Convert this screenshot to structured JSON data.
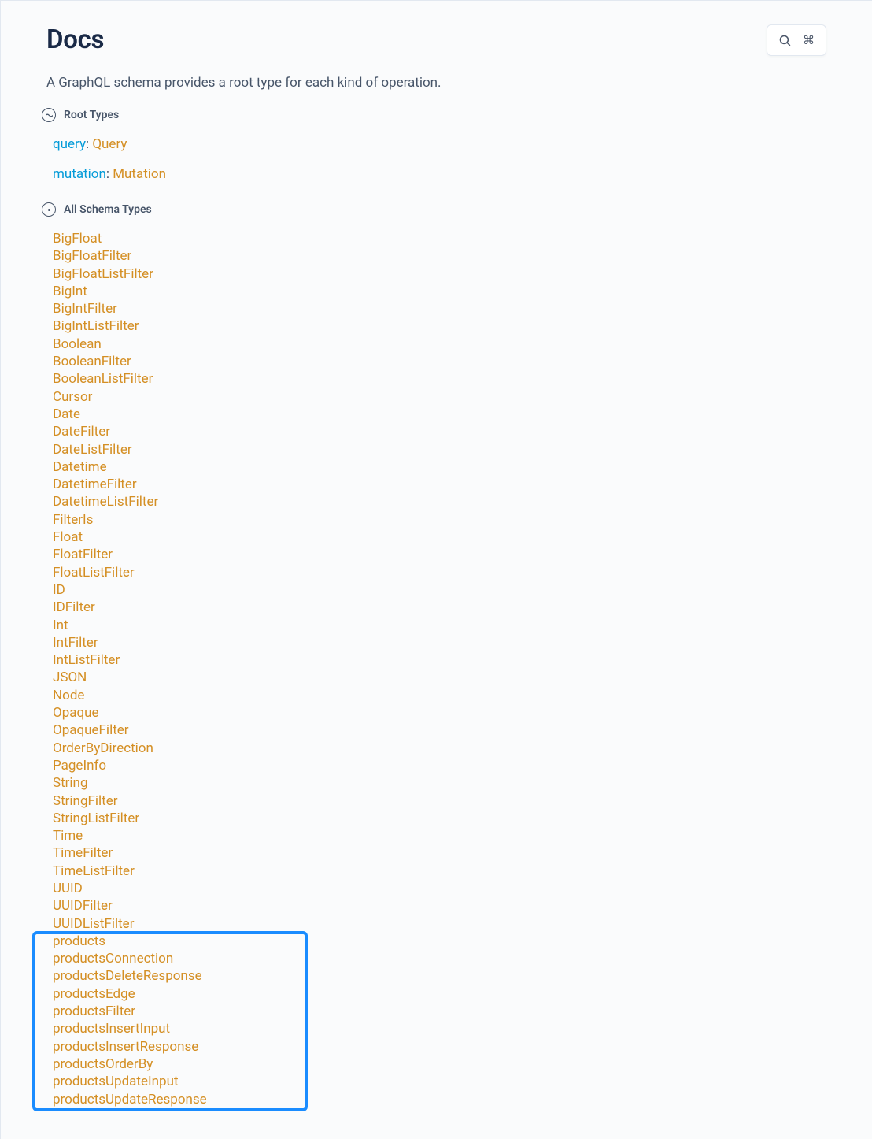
{
  "header": {
    "title": "Docs"
  },
  "description": "A GraphQL schema provides a root type for each kind of operation.",
  "sections": {
    "root_types_label": "Root Types",
    "all_schema_types_label": "All Schema Types"
  },
  "root_types": [
    {
      "key": "query",
      "value": "Query"
    },
    {
      "key": "mutation",
      "value": "Mutation"
    }
  ],
  "schema_types": [
    "BigFloat",
    "BigFloatFilter",
    "BigFloatListFilter",
    "BigInt",
    "BigIntFilter",
    "BigIntListFilter",
    "Boolean",
    "BooleanFilter",
    "BooleanListFilter",
    "Cursor",
    "Date",
    "DateFilter",
    "DateListFilter",
    "Datetime",
    "DatetimeFilter",
    "DatetimeListFilter",
    "FilterIs",
    "Float",
    "FloatFilter",
    "FloatListFilter",
    "ID",
    "IDFilter",
    "Int",
    "IntFilter",
    "IntListFilter",
    "JSON",
    "Node",
    "Opaque",
    "OpaqueFilter",
    "OrderByDirection",
    "PageInfo",
    "String",
    "StringFilter",
    "StringListFilter",
    "Time",
    "TimeFilter",
    "TimeListFilter",
    "UUID",
    "UUIDFilter",
    "UUIDListFilter",
    "products",
    "productsConnection",
    "productsDeleteResponse",
    "productsEdge",
    "productsFilter",
    "productsInsertInput",
    "productsInsertResponse",
    "productsOrderBy",
    "productsUpdateInput",
    "productsUpdateResponse"
  ],
  "highlight": {
    "start_index": 40,
    "end_index": 49
  }
}
